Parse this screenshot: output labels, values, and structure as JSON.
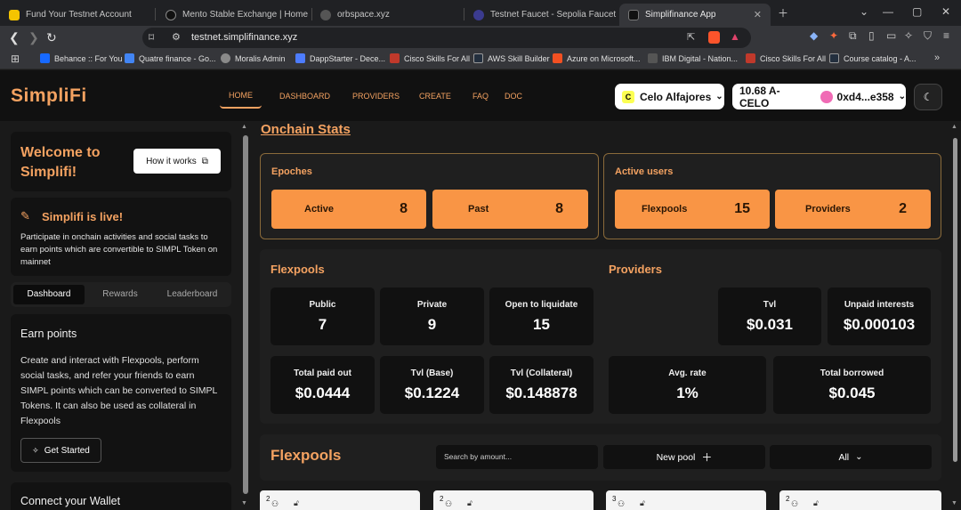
{
  "browser": {
    "tabs": [
      {
        "title": "Fund Your Testnet Account",
        "color": "#f4c400"
      },
      {
        "title": "Mento Stable Exchange | Home",
        "color": "#111111"
      },
      {
        "title": "orbspace.xyz",
        "color": "#555555"
      },
      {
        "title": "Testnet Faucet - Sepolia Faucet by th",
        "color": "#3b3b8f"
      },
      {
        "title": "Simplifinance App",
        "color": "#111111"
      }
    ],
    "url": "testnet.simplifinance.xyz",
    "bookmarks": [
      {
        "label": "Behance :: For You",
        "color": "#1769ff"
      },
      {
        "label": "Quatre finance - Go...",
        "color": "#4285f4"
      },
      {
        "label": "Moralis Admin",
        "color": "#8a8a8a"
      },
      {
        "label": "DappStarter - Dece...",
        "color": "#4d7cfe"
      },
      {
        "label": "Cisco Skills For All",
        "color": "#c0392b"
      },
      {
        "label": "AWS Skill Builder",
        "color": "#232f3e"
      },
      {
        "label": "Azure on Microsoft...",
        "color": "#f25022"
      },
      {
        "label": "IBM Digital - Nation...",
        "color": "#555555"
      },
      {
        "label": "Cisco Skills For All",
        "color": "#c0392b"
      },
      {
        "label": "Course catalog - A...",
        "color": "#232f3e"
      }
    ]
  },
  "header": {
    "logo": "SimpliFi",
    "nav": [
      "HOME",
      "DASHBOARD",
      "PROVIDERS",
      "CREATE",
      "FAQ",
      "DOC"
    ],
    "network": "Celo Alfajores",
    "balance": "10.68 A-CELO",
    "address": "0xd4...e358"
  },
  "sidebar": {
    "welcome": "Welcome to Simplifi!",
    "how_it_works": "How it works",
    "live_title": "Simplifi is live!",
    "live_text": "Participate in onchain activities and social tasks to earn points which are convertible to SIMPL Token on mainnet",
    "tabs": [
      "Dashboard",
      "Rewards",
      "Leaderboard"
    ],
    "earn_title": "Earn points",
    "earn_text": "Create and interact with Flexpools, perform social tasks, and refer your friends to earn SIMPL points which can be converted to SIMPL Tokens. It can also be used as collateral in Flexpools",
    "get_started": "Get Started",
    "connect_title": "Connect your Wallet"
  },
  "main": {
    "onchain_stats": "Onchain Stats",
    "epoches": {
      "title": "Epoches",
      "items": [
        {
          "label": "Active",
          "value": "8"
        },
        {
          "label": "Past",
          "value": "8"
        }
      ]
    },
    "active_users": {
      "title": "Active users",
      "items": [
        {
          "label": "Flexpools",
          "value": "15"
        },
        {
          "label": "Providers",
          "value": "2"
        }
      ]
    },
    "flexpools_title": "Flexpools",
    "providers_title": "Providers",
    "flexpools_stats": [
      {
        "label": "Public",
        "value": "7"
      },
      {
        "label": "Private",
        "value": "9"
      },
      {
        "label": "Open to liquidate",
        "value": "15"
      },
      {
        "label": "Total paid out",
        "value": "$0.0444"
      },
      {
        "label": "Tvl (Base)",
        "value": "$0.1224"
      },
      {
        "label": "Tvl (Collateral)",
        "value": "$0.148878"
      }
    ],
    "providers_stats": [
      {
        "label": "Tvl",
        "value": "$0.031"
      },
      {
        "label": "Unpaid interests",
        "value": "$0.000103"
      },
      {
        "label": "Avg. rate",
        "value": "1%"
      },
      {
        "label": "Total borrowed",
        "value": "$0.045"
      }
    ],
    "pool_section_title": "Flexpools",
    "search_placeholder": "Search by amount...",
    "new_pool": "New pool",
    "filter": "All",
    "pool_counts": [
      "2",
      "2",
      "3",
      "2"
    ]
  }
}
